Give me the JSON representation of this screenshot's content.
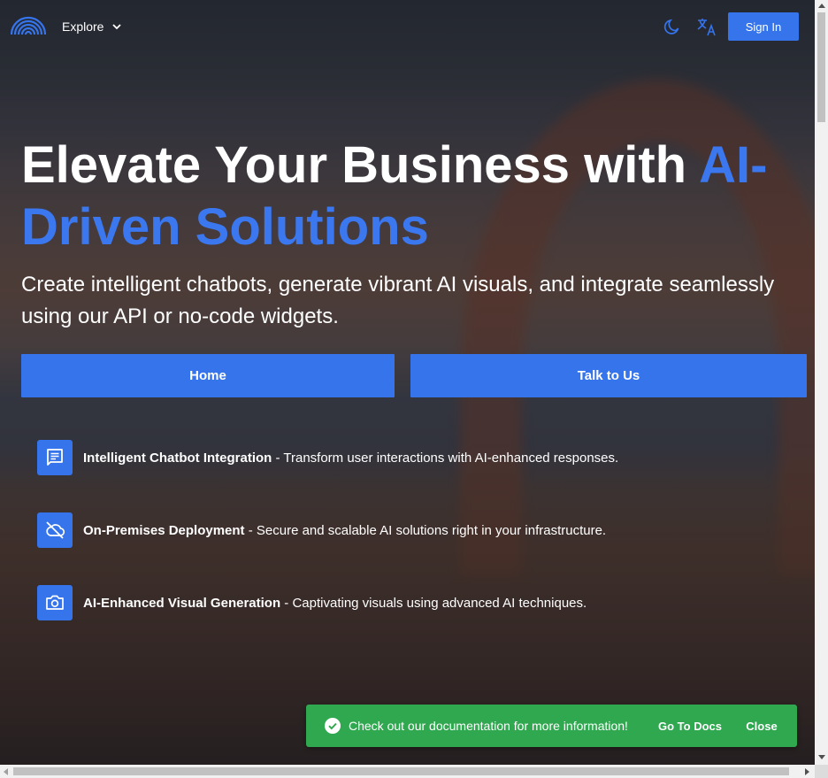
{
  "header": {
    "explore_label": "Explore",
    "signin_label": "Sign In",
    "icons": [
      "logo-arc-icon",
      "chevron-down-icon",
      "moon-icon",
      "translate-icon"
    ]
  },
  "hero": {
    "title_plain": "Elevate Your Business with ",
    "title_accent": "AI-Driven Solutions",
    "subtitle": "Create intelligent chatbots, generate vibrant AI visuals, and integrate seamlessly using our API or no-code widgets.",
    "home_button": "Home",
    "talk_button": "Talk to Us"
  },
  "features": [
    {
      "icon": "chat-icon",
      "title": "Intelligent Chatbot Integration",
      "description": " - Transform user interactions with AI-enhanced responses."
    },
    {
      "icon": "cloud-off-icon",
      "title": "On-Premises Deployment",
      "description": " - Secure and scalable AI solutions right in your infrastructure."
    },
    {
      "icon": "camera-icon",
      "title": "AI-Enhanced Visual Generation",
      "description": " - Captivating visuals using advanced AI techniques."
    }
  ],
  "toast": {
    "message": "Check out our documentation for more information!",
    "docs_button": "Go To Docs",
    "close_button": "Close"
  },
  "colors": {
    "accent": "#3574eb",
    "accent_text": "#3b78ef",
    "toast": "#2fa84f"
  }
}
